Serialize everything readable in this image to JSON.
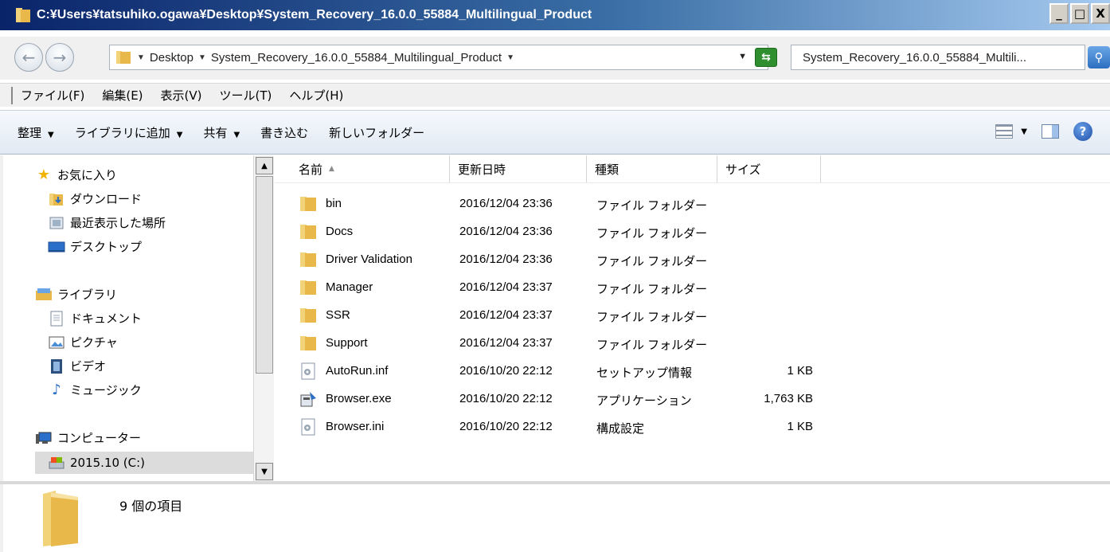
{
  "window": {
    "title": "C:¥Users¥tatsuhiko.ogawa¥Desktop¥System_Recovery_16.0.0_55884_Multilingual_Product",
    "buttons": {
      "minimize": "_",
      "maximize": "□",
      "close": "X"
    }
  },
  "address": {
    "crumbs": [
      "Desktop",
      "System_Recovery_16.0.0_55884_Multilingual_Product"
    ],
    "search_value": "System_Recovery_16.0.0_55884_Multili..."
  },
  "menu": {
    "items": [
      "ファイル(F)",
      "編集(E)",
      "表示(V)",
      "ツール(T)",
      "ヘルプ(H)"
    ]
  },
  "commands": {
    "organize": "整理",
    "add_to_library": "ライブラリに追加",
    "share": "共有",
    "burn": "書き込む",
    "new_folder": "新しいフォルダー"
  },
  "nav": {
    "favorites": "お気に入り",
    "downloads": "ダウンロード",
    "recent": "最近表示した場所",
    "desktop": "デスクトップ",
    "libraries": "ライブラリ",
    "documents": "ドキュメント",
    "pictures": "ピクチャ",
    "videos": "ビデオ",
    "music": "ミュージック",
    "computer": "コンピューター",
    "drive_c": "2015.10 (C:)"
  },
  "columns": {
    "name": "名前",
    "modified": "更新日時",
    "type": "種類",
    "size": "サイズ"
  },
  "files": [
    {
      "name": "bin",
      "modified": "2016/12/04 23:36",
      "type": "ファイル フォルダー",
      "size": "",
      "icon": "folder"
    },
    {
      "name": "Docs",
      "modified": "2016/12/04 23:36",
      "type": "ファイル フォルダー",
      "size": "",
      "icon": "folder"
    },
    {
      "name": "Driver Validation",
      "modified": "2016/12/04 23:36",
      "type": "ファイル フォルダー",
      "size": "",
      "icon": "folder"
    },
    {
      "name": "Manager",
      "modified": "2016/12/04 23:37",
      "type": "ファイル フォルダー",
      "size": "",
      "icon": "folder"
    },
    {
      "name": "SSR",
      "modified": "2016/12/04 23:37",
      "type": "ファイル フォルダー",
      "size": "",
      "icon": "folder"
    },
    {
      "name": "Support",
      "modified": "2016/12/04 23:37",
      "type": "ファイル フォルダー",
      "size": "",
      "icon": "folder"
    },
    {
      "name": "AutoRun.inf",
      "modified": "2016/10/20 22:12",
      "type": "セットアップ情報",
      "size": "1 KB",
      "icon": "settings-file"
    },
    {
      "name": "Browser.exe",
      "modified": "2016/10/20 22:12",
      "type": "アプリケーション",
      "size": "1,763 KB",
      "icon": "application"
    },
    {
      "name": "Browser.ini",
      "modified": "2016/10/20 22:12",
      "type": "構成設定",
      "size": "1 KB",
      "icon": "settings-file"
    }
  ],
  "details": {
    "count": "9 個の項目"
  },
  "colors": {
    "folder": "#e8b84a",
    "selection": "#dcdcdc",
    "title_gradient_start": "#0a246a"
  }
}
